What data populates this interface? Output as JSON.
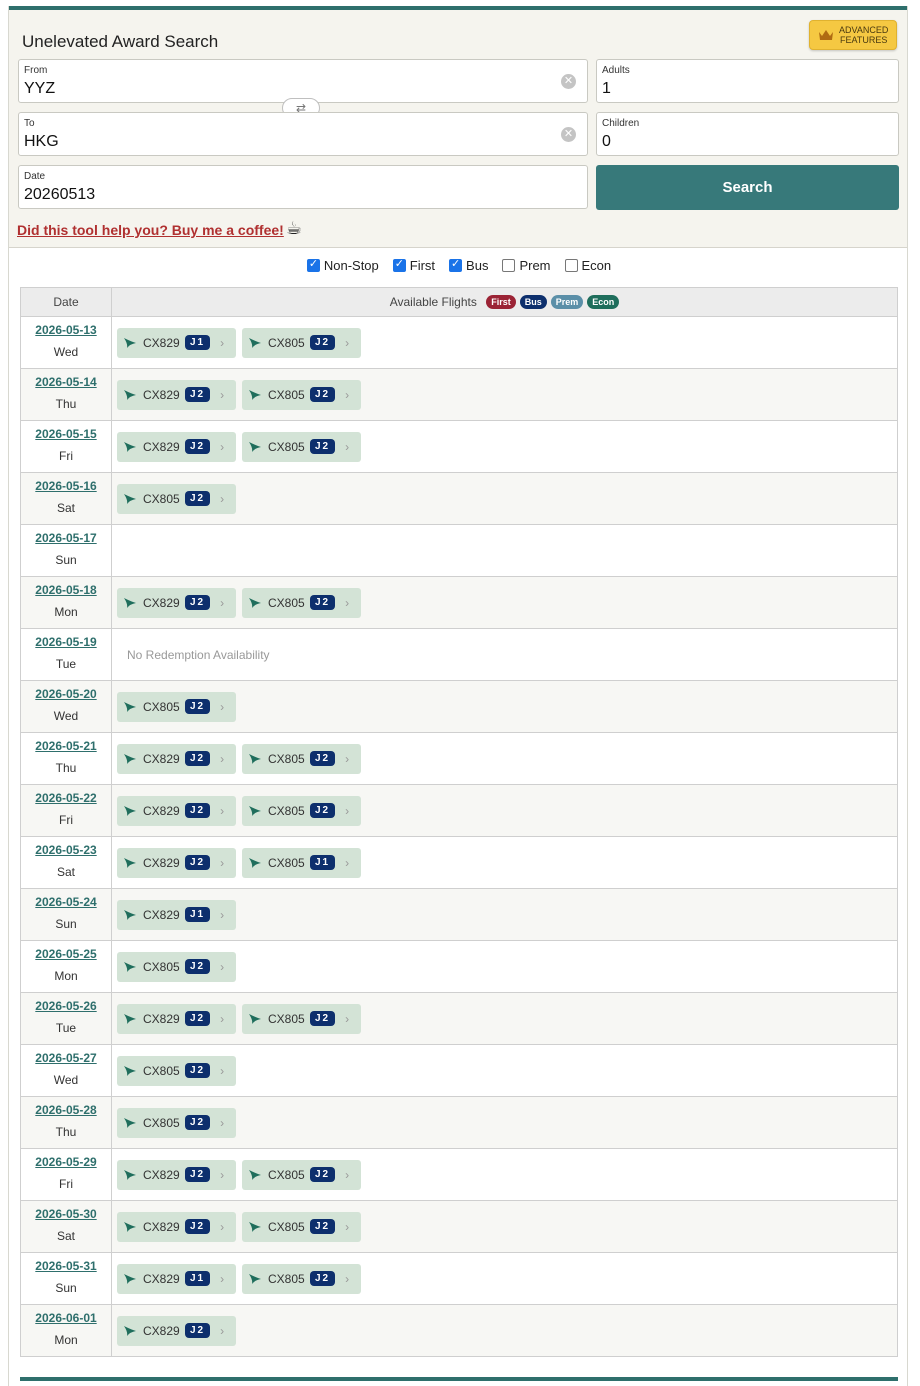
{
  "title": "Unelevated Award Search",
  "advanced": {
    "line1": "ADVANCED",
    "line2": "FEATURES"
  },
  "form": {
    "from_label": "From",
    "from_value": "YYZ",
    "to_label": "To",
    "to_value": "HKG",
    "date_label": "Date",
    "date_value": "20260513",
    "adults_label": "Adults",
    "adults_value": "1",
    "children_label": "Children",
    "children_value": "0",
    "search_label": "Search"
  },
  "coffee_link": "Did this tool help you? Buy me a coffee!",
  "filters": [
    {
      "label": "Non-Stop",
      "checked": true
    },
    {
      "label": "First",
      "checked": true
    },
    {
      "label": "Bus",
      "checked": true
    },
    {
      "label": "Prem",
      "checked": false
    },
    {
      "label": "Econ",
      "checked": false
    }
  ],
  "table": {
    "date_header": "Date",
    "flights_header": "Available Flights",
    "legend": [
      {
        "label": "First",
        "color": "#9b2335"
      },
      {
        "label": "Bus",
        "color": "#0d2f6d"
      },
      {
        "label": "Prem",
        "color": "#5b8fa8"
      },
      {
        "label": "Econ",
        "color": "#1f6e5c"
      }
    ],
    "no_availability_text": "No Redemption Availability",
    "rows": [
      {
        "date": "2026-05-13",
        "dow": "Wed",
        "flights": [
          {
            "fn": "CX829",
            "cls": "J1"
          },
          {
            "fn": "CX805",
            "cls": "J2"
          }
        ]
      },
      {
        "date": "2026-05-14",
        "dow": "Thu",
        "flights": [
          {
            "fn": "CX829",
            "cls": "J2"
          },
          {
            "fn": "CX805",
            "cls": "J2"
          }
        ]
      },
      {
        "date": "2026-05-15",
        "dow": "Fri",
        "flights": [
          {
            "fn": "CX829",
            "cls": "J2"
          },
          {
            "fn": "CX805",
            "cls": "J2"
          }
        ]
      },
      {
        "date": "2026-05-16",
        "dow": "Sat",
        "flights": [
          {
            "fn": "CX805",
            "cls": "J2"
          }
        ]
      },
      {
        "date": "2026-05-17",
        "dow": "Sun",
        "flights": []
      },
      {
        "date": "2026-05-18",
        "dow": "Mon",
        "flights": [
          {
            "fn": "CX829",
            "cls": "J2"
          },
          {
            "fn": "CX805",
            "cls": "J2"
          }
        ]
      },
      {
        "date": "2026-05-19",
        "dow": "Tue",
        "flights": [],
        "none": true
      },
      {
        "date": "2026-05-20",
        "dow": "Wed",
        "flights": [
          {
            "fn": "CX805",
            "cls": "J2"
          }
        ]
      },
      {
        "date": "2026-05-21",
        "dow": "Thu",
        "flights": [
          {
            "fn": "CX829",
            "cls": "J2"
          },
          {
            "fn": "CX805",
            "cls": "J2"
          }
        ]
      },
      {
        "date": "2026-05-22",
        "dow": "Fri",
        "flights": [
          {
            "fn": "CX829",
            "cls": "J2"
          },
          {
            "fn": "CX805",
            "cls": "J2"
          }
        ]
      },
      {
        "date": "2026-05-23",
        "dow": "Sat",
        "flights": [
          {
            "fn": "CX829",
            "cls": "J2"
          },
          {
            "fn": "CX805",
            "cls": "J1"
          }
        ]
      },
      {
        "date": "2026-05-24",
        "dow": "Sun",
        "flights": [
          {
            "fn": "CX829",
            "cls": "J1"
          }
        ]
      },
      {
        "date": "2026-05-25",
        "dow": "Mon",
        "flights": [
          {
            "fn": "CX805",
            "cls": "J2"
          }
        ]
      },
      {
        "date": "2026-05-26",
        "dow": "Tue",
        "flights": [
          {
            "fn": "CX829",
            "cls": "J2"
          },
          {
            "fn": "CX805",
            "cls": "J2"
          }
        ]
      },
      {
        "date": "2026-05-27",
        "dow": "Wed",
        "flights": [
          {
            "fn": "CX805",
            "cls": "J2"
          }
        ]
      },
      {
        "date": "2026-05-28",
        "dow": "Thu",
        "flights": [
          {
            "fn": "CX805",
            "cls": "J2"
          }
        ]
      },
      {
        "date": "2026-05-29",
        "dow": "Fri",
        "flights": [
          {
            "fn": "CX829",
            "cls": "J2"
          },
          {
            "fn": "CX805",
            "cls": "J2"
          }
        ]
      },
      {
        "date": "2026-05-30",
        "dow": "Sat",
        "flights": [
          {
            "fn": "CX829",
            "cls": "J2"
          },
          {
            "fn": "CX805",
            "cls": "J2"
          }
        ]
      },
      {
        "date": "2026-05-31",
        "dow": "Sun",
        "flights": [
          {
            "fn": "CX829",
            "cls": "J1"
          },
          {
            "fn": "CX805",
            "cls": "J2"
          }
        ]
      },
      {
        "date": "2026-06-01",
        "dow": "Mon",
        "flights": [
          {
            "fn": "CX829",
            "cls": "J2"
          }
        ]
      }
    ]
  }
}
